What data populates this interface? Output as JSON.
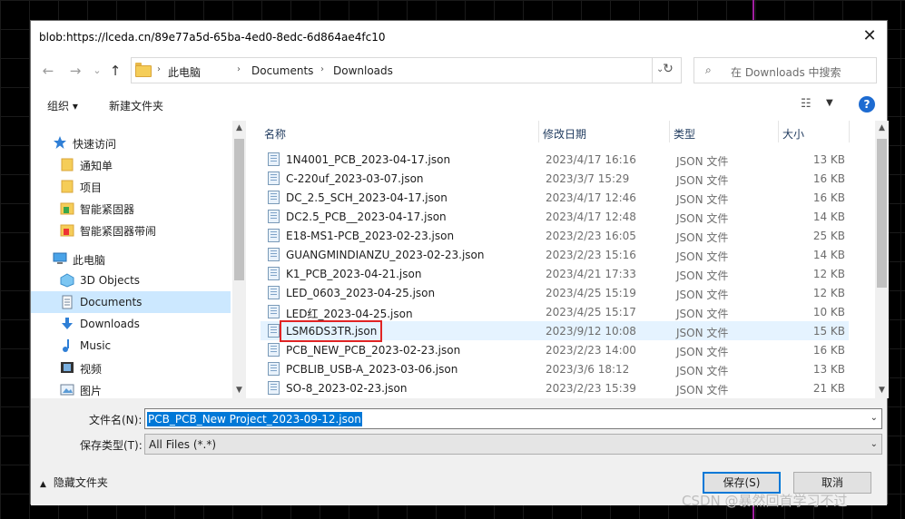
{
  "window": {
    "title": "blob:https://lceda.cn/89e77a5d-65ba-4ed0-8edc-6d864ae4fc10",
    "close_glyph": "✕"
  },
  "nav": {
    "back": "←",
    "forward": "→",
    "dropdown": "⌄",
    "up": "↑",
    "refresh": "↻"
  },
  "breadcrumb": {
    "sep": "›",
    "items": [
      "此电脑",
      "Documents",
      "Downloads"
    ],
    "dropdown": "⌄"
  },
  "search": {
    "icon": "⌕",
    "placeholder": "在 Downloads 中搜索"
  },
  "commands": {
    "organize": "组织 ▾",
    "new_folder": "新建文件夹",
    "view_icon": "☷",
    "view_dd": "▼",
    "help": "?"
  },
  "sidebar": {
    "items": [
      {
        "label": "快速访问",
        "icon": "star-icon"
      },
      {
        "label": "通知单",
        "icon": "folder-icon"
      },
      {
        "label": "项目",
        "icon": "folder-icon"
      },
      {
        "label": "智能紧固器",
        "icon": "folder-icon"
      },
      {
        "label": "智能紧固器带闹",
        "icon": "folder-icon"
      },
      {
        "label": "此电脑",
        "icon": "computer-icon"
      },
      {
        "label": "3D Objects",
        "icon": "cube-icon"
      },
      {
        "label": "Documents",
        "icon": "document-icon"
      },
      {
        "label": "Downloads",
        "icon": "download-icon"
      },
      {
        "label": "Music",
        "icon": "music-icon"
      },
      {
        "label": "视频",
        "icon": "video-icon"
      },
      {
        "label": "图片",
        "icon": "picture-icon"
      }
    ],
    "selected": "Documents"
  },
  "scroll": {
    "up": "▲",
    "down": "▼"
  },
  "list": {
    "columns": [
      "名称",
      "修改日期",
      "类型",
      "大小"
    ],
    "sort_caret": "^",
    "rows": [
      {
        "name": "1N4001_PCB_2023-04-17.json",
        "date": "2023/4/17 16:16",
        "type": "JSON 文件",
        "size": "13 KB"
      },
      {
        "name": "C-220uf_2023-03-07.json",
        "date": "2023/3/7 15:29",
        "type": "JSON 文件",
        "size": "16 KB"
      },
      {
        "name": "DC_2.5_SCH_2023-04-17.json",
        "date": "2023/4/17 12:46",
        "type": "JSON 文件",
        "size": "16 KB"
      },
      {
        "name": "DC2.5_PCB__2023-04-17.json",
        "date": "2023/4/17 12:48",
        "type": "JSON 文件",
        "size": "14 KB"
      },
      {
        "name": "E18-MS1-PCB_2023-02-23.json",
        "date": "2023/2/23 16:05",
        "type": "JSON 文件",
        "size": "25 KB"
      },
      {
        "name": "GUANGMINDIANZU_2023-02-23.json",
        "date": "2023/2/23 15:16",
        "type": "JSON 文件",
        "size": "14 KB"
      },
      {
        "name": "K1_PCB_2023-04-21.json",
        "date": "2023/4/21 17:33",
        "type": "JSON 文件",
        "size": "12 KB"
      },
      {
        "name": "LED_0603_2023-04-25.json",
        "date": "2023/4/25 15:19",
        "type": "JSON 文件",
        "size": "12 KB"
      },
      {
        "name": "LED红_2023-04-25.json",
        "date": "2023/4/25 15:17",
        "type": "JSON 文件",
        "size": "10 KB"
      },
      {
        "name": "LSM6DS3TR.json",
        "date": "2023/9/12 10:08",
        "type": "JSON 文件",
        "size": "15 KB"
      },
      {
        "name": "PCB_NEW_PCB_2023-02-23.json",
        "date": "2023/2/23 14:00",
        "type": "JSON 文件",
        "size": "16 KB"
      },
      {
        "name": "PCBLIB_USB-A_2023-03-06.json",
        "date": "2023/3/6 18:12",
        "type": "JSON 文件",
        "size": "13 KB"
      },
      {
        "name": "SO-8_2023-02-23.json",
        "date": "2023/2/23 15:39",
        "type": "JSON 文件",
        "size": "21 KB"
      }
    ],
    "highlighted_name": "LSM6DS3TR.json"
  },
  "footer": {
    "filename_label": "文件名(N):",
    "filename_value": "PCB_PCB_New Project_2023-09-12.json",
    "filetype_label": "保存类型(T):",
    "filetype_value": "All Files (*.*)",
    "dd": "⌄",
    "hide_folders": "隐藏文件夹",
    "hide_caret": "▲",
    "save": "保存(S)",
    "cancel": "取消"
  },
  "watermark": "CSDN @暴然回首学习不过",
  "colors": {
    "accent": "#0078d7",
    "selection": "#cce8ff",
    "hover": "#e5f3ff",
    "highlight_box": "#e02424"
  }
}
